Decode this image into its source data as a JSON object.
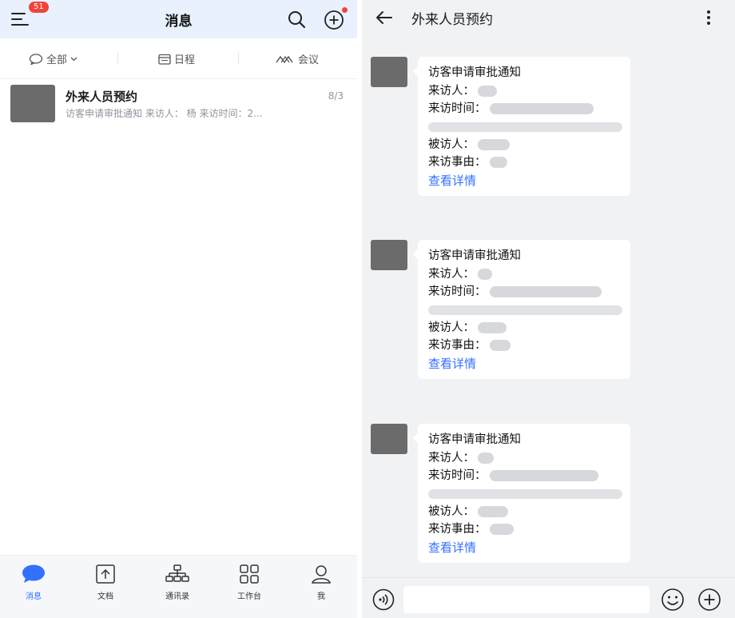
{
  "left": {
    "header": {
      "title": "消息",
      "badge": "51"
    },
    "filters": [
      {
        "label": "全部",
        "icon": "chat-bubble-icon"
      },
      {
        "label": "日程",
        "icon": "calendar-icon"
      },
      {
        "label": "会议",
        "icon": "meeting-icon"
      }
    ],
    "conversation": {
      "name": "外来人员预约",
      "time": "8/3",
      "preview": "访客申请审批通知 来访人：  杨 来访时间：2..."
    },
    "nav": [
      {
        "label": "消息",
        "icon": "message-icon",
        "active": true
      },
      {
        "label": "文档",
        "icon": "document-icon",
        "active": false
      },
      {
        "label": "通讯录",
        "icon": "contacts-icon",
        "active": false
      },
      {
        "label": "工作台",
        "icon": "workspace-icon",
        "active": false
      },
      {
        "label": "我",
        "icon": "profile-icon",
        "active": false
      }
    ]
  },
  "right": {
    "header": {
      "title": "外来人员预约"
    },
    "messages": [
      {
        "title": "访客申请审批通知",
        "visitor_label": "来访人：",
        "time_label": "来访时间：",
        "host_label": "被访人：",
        "reason_label": "来访事由：",
        "link": "查看详情"
      },
      {
        "title": "访客申请审批通知",
        "visitor_label": "来访人：",
        "time_label": "来访时间：",
        "host_label": "被访人：",
        "reason_label": "来访事由：",
        "link": "查看详情"
      },
      {
        "title": "访客申请审批通知",
        "visitor_label": "来访人：",
        "time_label": "来访时间：",
        "host_label": "被访人：",
        "reason_label": "来访事由：",
        "link": "查看详情"
      }
    ],
    "input": {
      "value": "",
      "placeholder": ""
    }
  },
  "colors": {
    "accent": "#3370ff",
    "badge": "#f0433a",
    "header_bg": "#e8f1fd",
    "chat_bg": "#f1f2f4"
  }
}
